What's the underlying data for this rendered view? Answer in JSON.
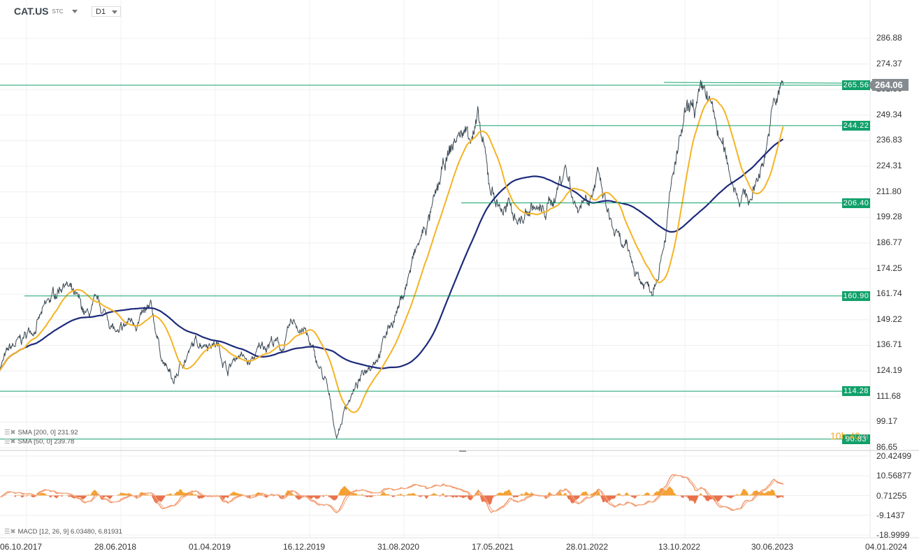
{
  "header": {
    "symbol": "CAT.US",
    "market": "STC",
    "timeframe": "D1"
  },
  "current_price": "264.06",
  "countdown": {
    "hours": "10h",
    "minutes": "40",
    "unit": "m"
  },
  "legend": {
    "sma200": "SMA [200, 0] 231.92",
    "sma50": "SMA [50, 0] 239.78",
    "macd": "MACD [12, 26, 9] 6.03480, 6.81931"
  },
  "colors": {
    "price": "#3c4a55",
    "sma50": "#f5b324",
    "sma200": "#1c2a7a",
    "level": "#10a06a",
    "macd": "#f08a5a",
    "hist_pos": "#f5a030",
    "hist_neg": "#e8704a"
  },
  "chart_data": {
    "type": "line",
    "title": "CAT.US D1",
    "x_ticks": [
      "06.10.2017",
      "28.06.2018",
      "01.04.2019",
      "16.12.2019",
      "31.08.2020",
      "17.05.2021",
      "28.01.2022",
      "13.10.2022",
      "30.06.2023",
      "04.01.2024"
    ],
    "y_ticks": [
      "286.88",
      "274.37",
      "261.86",
      "249.34",
      "236.83",
      "224.31",
      "211.80",
      "199.28",
      "186.77",
      "174.25",
      "161.74",
      "149.22",
      "136.71",
      "124.19",
      "111.68",
      "99.17",
      "86.65"
    ],
    "ylim": [
      86.65,
      286.88
    ],
    "macd_ticks": [
      "20.42499",
      "10.56877",
      "0.71255",
      "-9.1437",
      "-18.9999"
    ],
    "macd_ylim": [
      -18.9999,
      20.42499
    ],
    "price_monthly": {
      "months_from_oct_2017": [
        -2,
        -1,
        0,
        1,
        2,
        3,
        4,
        5,
        6,
        7,
        8,
        9,
        10,
        11,
        12,
        13,
        14,
        15,
        16,
        17,
        18,
        19,
        20,
        21,
        22,
        23,
        24,
        25,
        26,
        27,
        28,
        29,
        30,
        31,
        32,
        33,
        34,
        35,
        36,
        37,
        38,
        39,
        40,
        41,
        42,
        43,
        44,
        45,
        46,
        47,
        48,
        49,
        50,
        51,
        52,
        53,
        54,
        55,
        56,
        57,
        58,
        59,
        60,
        61,
        62,
        63,
        64,
        65,
        66,
        67,
        68,
        69,
        70
      ],
      "close": [
        126,
        134,
        138,
        145,
        152,
        160,
        170,
        158,
        150,
        155,
        150,
        140,
        148,
        150,
        152,
        130,
        118,
        130,
        137,
        140,
        138,
        125,
        133,
        127,
        135,
        140,
        135,
        147,
        145,
        130,
        118,
        92,
        110,
        118,
        128,
        136,
        148,
        160,
        178,
        192,
        205,
        225,
        238,
        242,
        245,
        215,
        205,
        202,
        198,
        205,
        200,
        210,
        225,
        205,
        212,
        218,
        198,
        185,
        178,
        168,
        165,
        190,
        222,
        245,
        252,
        258,
        240,
        222,
        212,
        208,
        225,
        250,
        264
      ]
    },
    "levels": [
      "265.56",
      "244.22",
      "206.40",
      "160.90",
      "114.28",
      "90.83"
    ]
  }
}
